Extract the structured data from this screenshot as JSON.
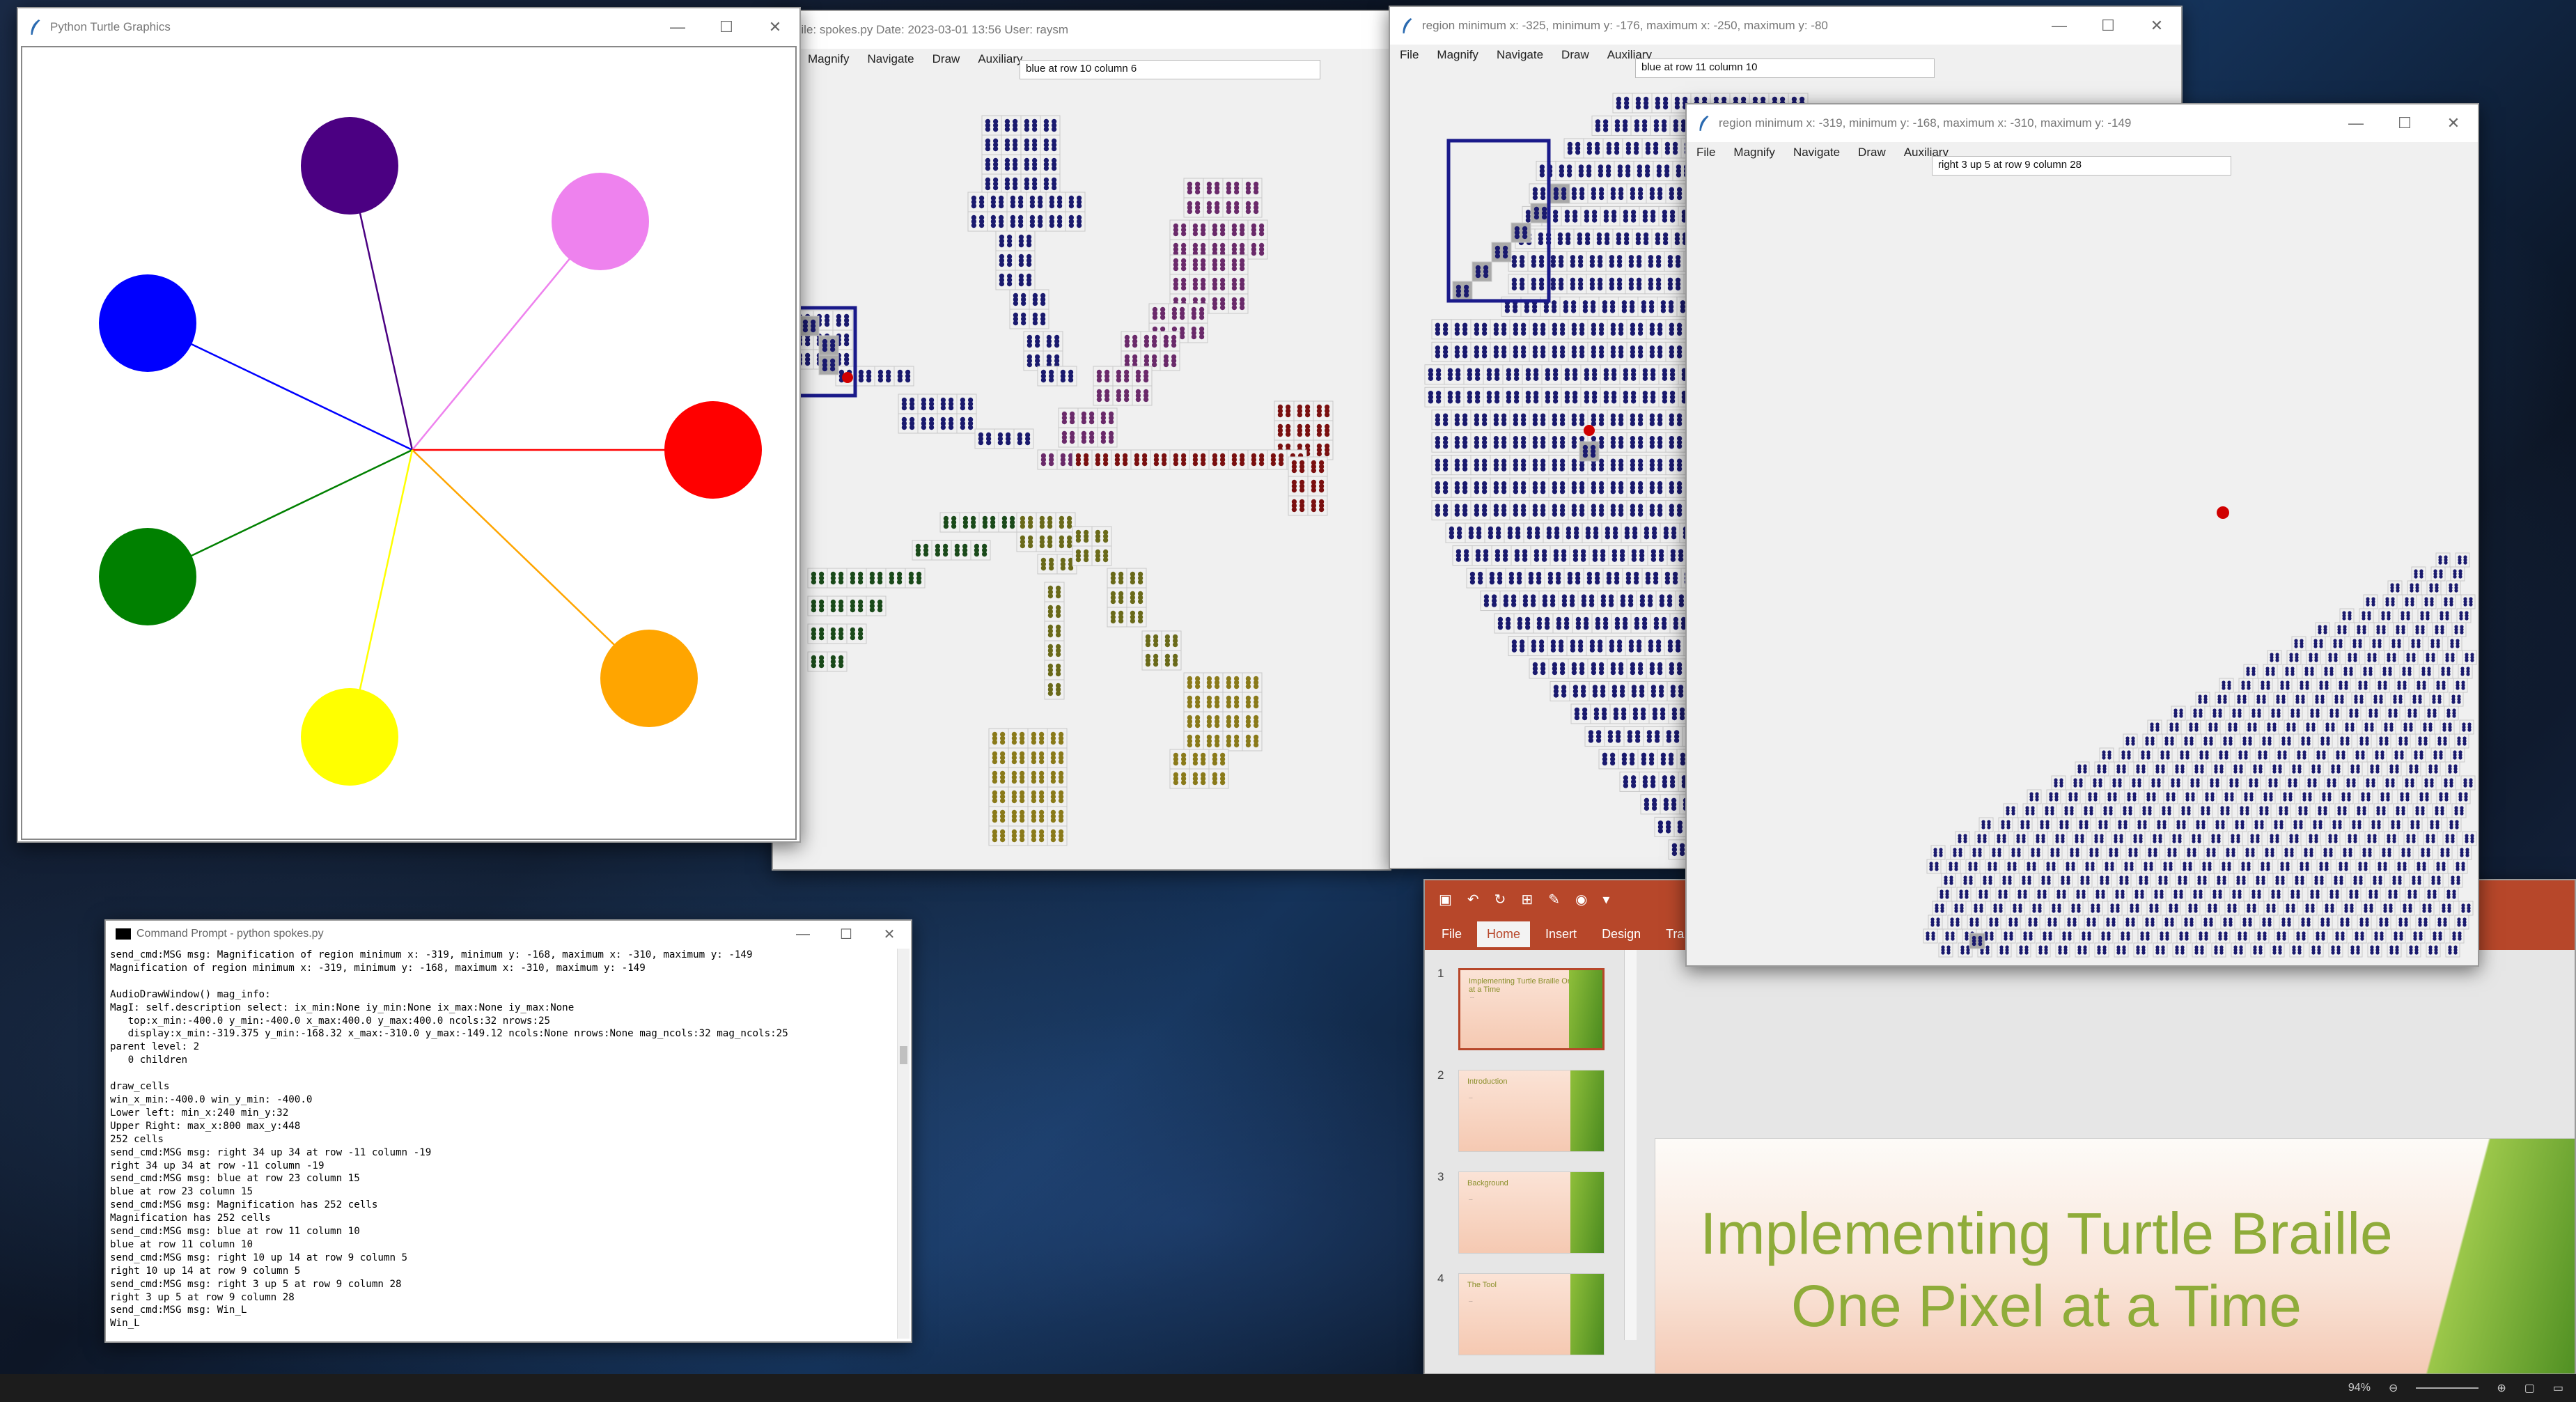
{
  "turtle_window": {
    "title": "Python Turtle Graphics",
    "spokes": [
      {
        "color": "#4b0082",
        "name": "indigo"
      },
      {
        "color": "#ee82ee",
        "name": "violet"
      },
      {
        "color": "#0000ff",
        "name": "blue"
      },
      {
        "color": "#ff0000",
        "name": "red"
      },
      {
        "color": "#008000",
        "name": "green"
      },
      {
        "color": "#ffa500",
        "name": "orange"
      },
      {
        "color": "#ffff00",
        "name": "yellow"
      }
    ]
  },
  "braille_main": {
    "title": "File: spokes.py  Date: 2023-03-01 13:56  User: raysm",
    "menu": [
      "Magnify",
      "Navigate",
      "Draw",
      "Auxiliary"
    ],
    "status": "blue at row 10 column 6"
  },
  "region1": {
    "title": "region minimum x: -325, minimum y: -176, maximum x: -250, maximum y: -80",
    "menu": [
      "File",
      "Magnify",
      "Navigate",
      "Draw",
      "Auxiliary"
    ],
    "status": "blue at row 11 column 10"
  },
  "region2": {
    "title": "region minimum x: -319, minimum y: -168, maximum x: -310, maximum y: -149",
    "menu": [
      "File",
      "Magnify",
      "Navigate",
      "Draw",
      "Auxiliary"
    ],
    "status": "right 3 up 5 at row 9 column 28"
  },
  "cmd": {
    "title": "Command Prompt - python  spokes.py",
    "lines": [
      "send_cmd:MSG msg: Magnification of region minimum x: -319, minimum y: -168, maximum x: -310, maximum y: -149",
      "Magnification of region minimum x: -319, minimum y: -168, maximum x: -310, maximum y: -149",
      "",
      "AudioDrawWindow() mag_info:",
      "MagI: self.description select: ix_min:None iy_min:None ix_max:None iy_max:None",
      "   top:x_min:-400.0 y_min:-400.0 x_max:400.0 y_max:400.0 ncols:32 nrows:25",
      "   display:x_min:-319.375 y_min:-168.32 x_max:-310.0 y_max:-149.12 ncols:None nrows:None mag_ncols:32 mag_ncols:25",
      "parent level: 2",
      "   0 children",
      "",
      "draw_cells",
      "win_x_min:-400.0 win_y_min: -400.0",
      "Lower left: min_x:240 min_y:32",
      "Upper Right: max_x:800 max_y:448",
      "252 cells",
      "send_cmd:MSG msg: right 34 up 34 at row -11 column -19",
      "right 34 up 34 at row -11 column -19",
      "send_cmd:MSG msg: blue at row 23 column 15",
      "blue at row 23 column 15",
      "send_cmd:MSG msg: Magnification has 252 cells",
      "Magnification has 252 cells",
      "send_cmd:MSG msg: blue at row 11 column 10",
      "blue at row 11 column 10",
      "send_cmd:MSG msg: right 10 up 14 at row 9 column 5",
      "right 10 up 14 at row 9 column 5",
      "send_cmd:MSG msg: right 3 up 5 at row 9 column 28",
      "right 3 up 5 at row 9 column 28",
      "send_cmd:MSG msg: Win_L",
      "Win_L"
    ]
  },
  "powerpoint": {
    "tabs": [
      "File",
      "Home",
      "Insert",
      "Design",
      "Tra"
    ],
    "active_tab": "Home",
    "accent": "#b7472a",
    "thumbnails": [
      {
        "num": "1",
        "title": "Implementing Turtle Braille One Pixel at a Time",
        "body": "..."
      },
      {
        "num": "2",
        "title": "Introduction",
        "body": "..."
      },
      {
        "num": "3",
        "title": "Background",
        "body": "..."
      },
      {
        "num": "4",
        "title": "The Tool",
        "body": "..."
      }
    ],
    "slide_title_1": "Implementing Turtle Braille",
    "slide_title_2": "One Pixel at a Time"
  },
  "taskbar": {
    "zoom": "94%"
  }
}
